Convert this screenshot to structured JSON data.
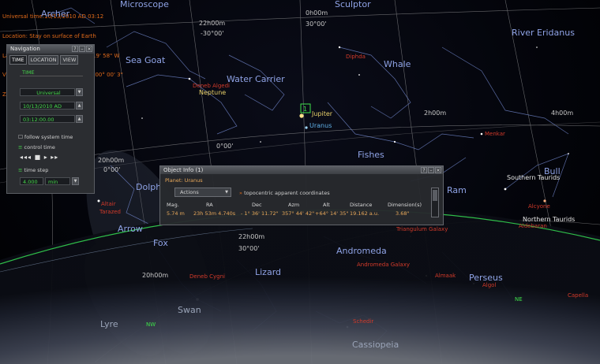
{
  "status_lines": [
    "Universal time:10/13/2010 AD 03:12",
    "Location: Stay on surface of Earth",
    "Lat = 27° 20' 35\" E  Lon = 070° 19' 58\" W",
    "View: Azm = 352° 35' 35\"  Alt = -00° 00' 3\"",
    "Zoom = 0.40"
  ],
  "constellations": [
    "Archer",
    "Microscope",
    "Sculptor",
    "River Eridanus",
    "Sea Goat",
    "Water Carrier",
    "Whale",
    "Fishes",
    "Bull",
    "Ram",
    "Dolph",
    "Arrow",
    "Fox",
    "Lizard",
    "Andromeda",
    "Perseus",
    "Swan",
    "Lyre",
    "Cassiopeia"
  ],
  "stars": [
    "Diphda",
    "Deneb Algedi",
    "Menkar",
    "Alcyone",
    "Aldebaran",
    "Altair",
    "Tarazed",
    "Triangulum Galaxy",
    "Andromeda Galaxy",
    "Almaak",
    "Deneb Cygni",
    "Algol",
    "Schedir",
    "Capella"
  ],
  "clusters": [
    "Southern Taurids",
    "Northern Taurids"
  ],
  "planets": [
    "Neptune",
    "Jupiter",
    "Uranus"
  ],
  "coords": [
    "22h00m",
    "0h00m",
    "-30°00'",
    "30°00'",
    "2h00m",
    "4h00m",
    "0°00'",
    "20h00m",
    "20h00m",
    "30°00'",
    "0°00'",
    "22h00m"
  ],
  "horizon": [
    "NW",
    "NE"
  ],
  "selection_marker": "1",
  "navigation": {
    "title": "Navigation",
    "tabs": [
      "TIME",
      "LOCATION",
      "VIEW"
    ],
    "time_label": "TIME",
    "timezone": "Universal",
    "date": "10/13/2010  AD",
    "time": "03:12:00.00",
    "follow_label": "follow system time",
    "control_label": "control time",
    "step_label": "time step",
    "step_value": "4.000",
    "step_unit": "min"
  },
  "object_info": {
    "title": "Object Info (1)",
    "planet": "Planet: Uranus",
    "actions": "Actions",
    "topo": "topocentric apparent coordinates",
    "headers": [
      "Mag.",
      "RA",
      "Dec",
      "Azm",
      "Alt",
      "Distance",
      "Dimension(s)"
    ],
    "values": [
      "5.74 m",
      "23h 53m 4.740s",
      "- 1° 36' 11.72\"",
      "357° 44' 42\"",
      "+64° 14' 35\"",
      "19.162 a.u.",
      "3.68\""
    ]
  },
  "colors": {
    "constellation": "#8fa3e6",
    "star_label": "#d23a2a",
    "planet_label": "#e8d06a",
    "status_text": "#e06a1a",
    "nav_green": "#45d84a",
    "horizon_line": "#2fbf4a"
  }
}
